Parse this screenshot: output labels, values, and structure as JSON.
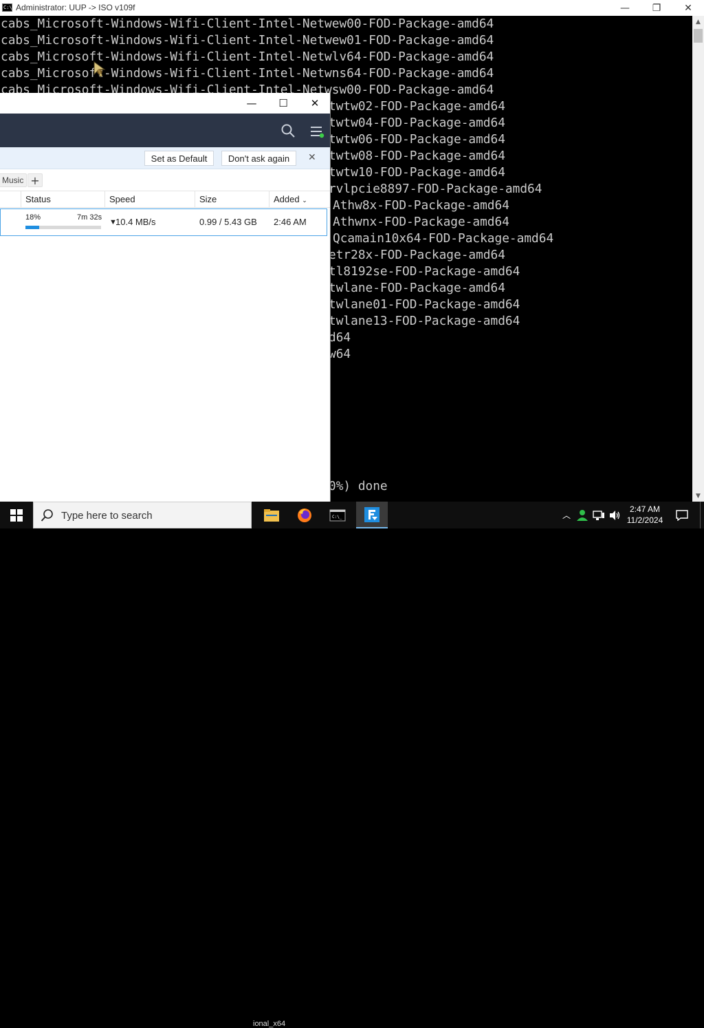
{
  "console": {
    "title": "Administrator:  UUP -> ISO v109f",
    "lines": [
      {
        "text": "cabs_Microsoft-Windows-Wifi-Client-Intel-Netwew00-FOD-Package-amd64"
      },
      {
        "text": "cabs_Microsoft-Windows-Wifi-Client-Intel-Netwew01-FOD-Package-amd64"
      },
      {
        "text": "cabs_Microsoft-Windows-Wifi-Client-Intel-Netwlv64-FOD-Package-amd64"
      },
      {
        "text": "cabs_Microsoft-Windows-Wifi-Client-Intel-Netwns64-FOD-Package-amd64"
      },
      {
        "text": "cabs_Microsoft-Windows-Wifi-Client-Intel-Netwsw00-FOD-Package-amd64"
      },
      {
        "text": "twtw02-FOD-Package-amd64"
      },
      {
        "text": "twtw04-FOD-Package-amd64"
      },
      {
        "text": "twtw06-FOD-Package-amd64"
      },
      {
        "text": "twtw08-FOD-Package-amd64"
      },
      {
        "text": "twtw10-FOD-Package-amd64"
      },
      {
        "text": "rvlpcie8897-FOD-Package-amd64"
      },
      {
        "text": "Athw8x-FOD-Package-amd64"
      },
      {
        "text": "Athwnx-FOD-Package-amd64"
      },
      {
        "text": "Qcamain10x64-FOD-Package-amd64"
      },
      {
        "text": "etr28x-FOD-Package-amd64"
      },
      {
        "text": "tl8192se-FOD-Package-amd64"
      },
      {
        "text": "twlane-FOD-Package-amd64"
      },
      {
        "text": "twlane01-FOD-Package-amd64"
      },
      {
        "text": "twlane13-FOD-Package-amd64"
      },
      {
        "text": "d64"
      },
      {
        "text": "w64"
      },
      {
        "text": "0%) done"
      }
    ]
  },
  "downloader": {
    "banner": {
      "set_default": "Set as Default",
      "dont_ask": "Don't ask again",
      "close_glyph": "✕"
    },
    "tabs": {
      "music": "Music",
      "add": "+"
    },
    "columns": {
      "status": "Status",
      "speed": "Speed",
      "size": "Size",
      "added": "Added"
    },
    "rows": [
      {
        "percent_label": "18%",
        "progress": 0.18,
        "eta": "7m 32s",
        "speed": "10.4 MB/s",
        "size": "0.99 / 5.43 GB",
        "added": "2:46 AM"
      }
    ]
  },
  "taskbar": {
    "search_placeholder": "Type here to search",
    "tooltip": "ional_x64",
    "clock_time": "2:47 AM",
    "clock_date": "11/2/2024"
  },
  "colors": {
    "header_bg": "#2c3547",
    "banner_bg": "#e8f1fb",
    "progress": "#1f8ee0",
    "row_border": "#4aa3e6",
    "console_text": "#cccccc"
  }
}
